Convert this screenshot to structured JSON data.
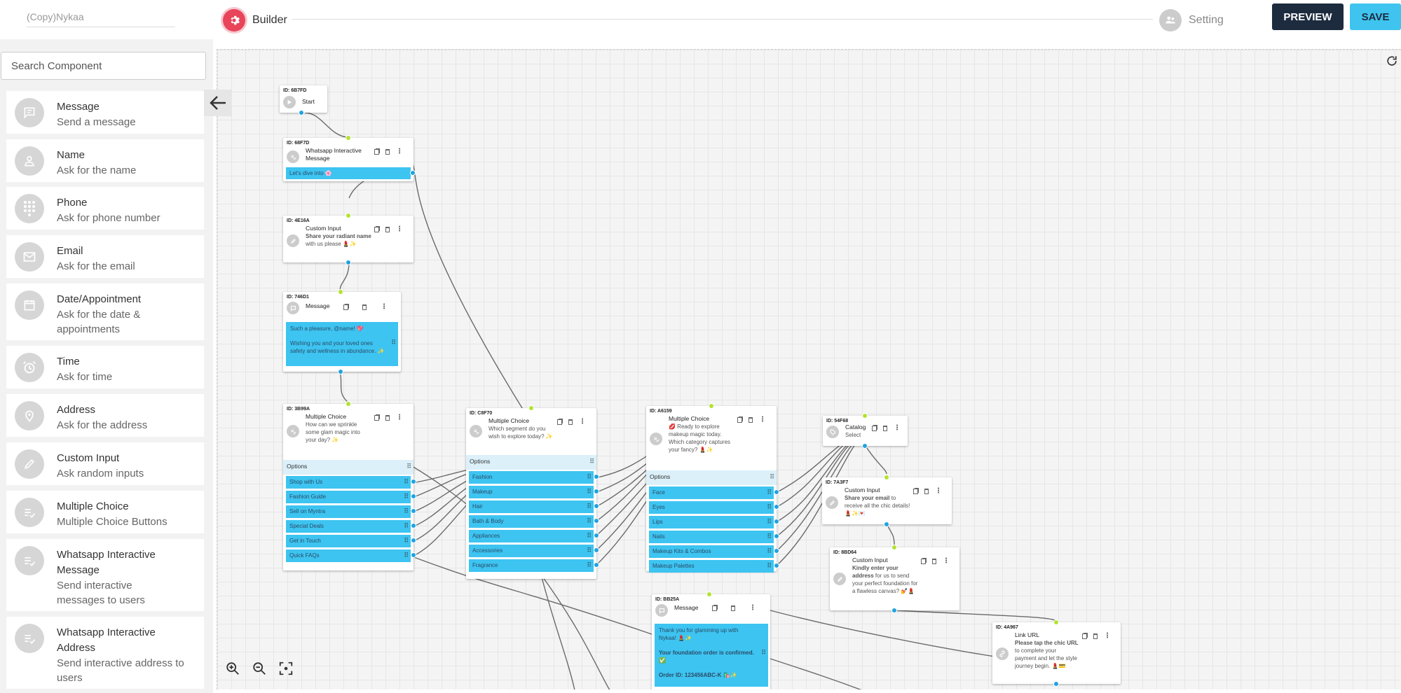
{
  "topbar": {
    "bot_name": "(Copy)Nykaa",
    "builder_label": "Builder",
    "setting_label": "Setting",
    "preview_label": "PREVIEW",
    "save_label": "SAVE"
  },
  "sidebar": {
    "search_placeholder": "Search Component",
    "components": [
      {
        "title": "Message",
        "subtitle": "Send a message",
        "icon": "message-icon"
      },
      {
        "title": "Name",
        "subtitle": "Ask for the name",
        "icon": "person-icon"
      },
      {
        "title": "Phone",
        "subtitle": "Ask for phone number",
        "icon": "dialpad-icon"
      },
      {
        "title": "Email",
        "subtitle": "Ask for the email",
        "icon": "envelope-icon"
      },
      {
        "title": "Date/Appointment",
        "subtitle": "Ask for the date & appointments",
        "icon": "calendar-icon"
      },
      {
        "title": "Time",
        "subtitle": "Ask for time",
        "icon": "alarm-clock-icon"
      },
      {
        "title": "Address",
        "subtitle": "Ask for the address",
        "icon": "location-pin-icon"
      },
      {
        "title": "Custom Input",
        "subtitle": "Ask random inputs",
        "icon": "pencil-icon"
      },
      {
        "title": "Multiple Choice",
        "subtitle": "Multiple Choice Buttons",
        "icon": "checklist-icon"
      },
      {
        "title": "Whatsapp Interactive Message",
        "subtitle": "Send interactive messages to users",
        "icon": "checklist-icon"
      },
      {
        "title": "Whatsapp Interactive Address",
        "subtitle": "Send interactive address to users",
        "icon": "checklist-icon"
      }
    ]
  },
  "nodes": {
    "start": {
      "id": "ID: 6B7FD",
      "title": "Start"
    },
    "wa_msg": {
      "id": "ID: 68F7D",
      "title": "Whatsapp Interactive Message",
      "body": "Let's dive into 🌸"
    },
    "name_input": {
      "id": "ID: 4E16A",
      "title": "Custom Input",
      "desc_bold": "Share your radiant name",
      "desc_rest": " with us please 💄✨"
    },
    "greet_msg": {
      "id": "ID: 746D1",
      "title": "Message",
      "body_line1": "Such a pleasure, @name! 💖",
      "body_line2": "Wishing you and your loved ones safety and wellness in abundance. ✨"
    },
    "mc1": {
      "id": "ID: 3B99A",
      "title": "Multiple Choice",
      "desc": "How can we sprinkle some glam magic into your day? ✨",
      "options_label": "Options",
      "options": [
        "Shop with Us",
        "Fashion Guide",
        "Sell on Myntra",
        "Special Deals",
        "Get in Touch",
        "Quick FAQs"
      ]
    },
    "mc2": {
      "id": "ID: C8F70",
      "title": "Multiple Choice",
      "desc": "Which segment do you wish to explore today? ✨",
      "options_label": "Options",
      "options": [
        "Fashion",
        "Makeup",
        "Hair",
        "Bath & Body",
        "Appliances",
        "Accessories",
        "Fragrance"
      ]
    },
    "mc3": {
      "id": "ID: A6159",
      "title": "Multiple Choice",
      "desc": "💋 Ready to explore makeup magic today. Which category captures your fancy? 💄✨",
      "options_label": "Options",
      "options": [
        "Face",
        "Eyes",
        "Lips",
        "Nails",
        "Makeup Kits & Combos",
        "Makeup Palettes"
      ]
    },
    "catalog": {
      "id": "ID: 54F68",
      "title": "Catalog",
      "desc": "Select"
    },
    "email_input": {
      "id": "ID: 7A3F7",
      "title": "Custom Input",
      "desc_bold": "Share your email",
      "desc_rest": " to receive all the chic details! 💄✨💌"
    },
    "addr_input": {
      "id": "ID: 8BD64",
      "title": "Custom Input",
      "desc_bold": "Kindly enter your address",
      "desc_rest": " for us to send your perfect foundation for a flawless canvas? 💅💄"
    },
    "thanks_msg": {
      "id": "ID: BB25A",
      "title": "Message",
      "line1": "Thank you for glamming up with Nykaa! 💄✨",
      "line2": "Your foundation order is confirmed. ✅",
      "line3": "Order ID: 123456ABC-K 🛍️✨"
    },
    "link_url": {
      "id": "ID: 4A967",
      "title": "Link URL",
      "desc_bold1": "Please tap the chic URL",
      "desc_rest": " to complete your payment and let the style journey begin. 💄💳"
    }
  }
}
